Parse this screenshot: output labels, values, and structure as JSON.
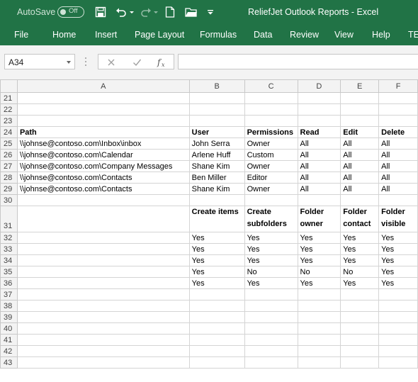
{
  "title_bar": {
    "autosave_label": "AutoSave",
    "autosave_state": "Off",
    "document_title": "ReliefJet Outlook Reports  -  Excel"
  },
  "ribbon": {
    "tabs": [
      "File",
      "Home",
      "Insert",
      "Page Layout",
      "Formulas",
      "Data",
      "Review",
      "View",
      "Help",
      "TE"
    ]
  },
  "formula_bar": {
    "name_box": "A34",
    "formula": ""
  },
  "colors": {
    "accent": "#217346",
    "header_bg": "#f3f3f3",
    "gridline": "#d4d4d4"
  },
  "sheet": {
    "columns": [
      "A",
      "B",
      "C",
      "D",
      "E",
      "F"
    ],
    "rows": [
      {
        "num": "21",
        "cells": [
          "",
          "",
          "",
          "",
          "",
          ""
        ]
      },
      {
        "num": "22",
        "cells": [
          "",
          "",
          "",
          "",
          "",
          ""
        ]
      },
      {
        "num": "23",
        "cells": [
          "",
          "",
          "",
          "",
          "",
          ""
        ]
      },
      {
        "num": "24",
        "cells": [
          "Path",
          "User",
          "Permissions",
          "Read",
          "Edit",
          "Delete"
        ],
        "bold": true
      },
      {
        "num": "25",
        "cells": [
          "\\\\johnse@contoso.com\\Inbox\\inbox",
          "John Serra",
          "Owner",
          "All",
          "All",
          "All"
        ]
      },
      {
        "num": "26",
        "cells": [
          "\\\\johnse@contoso.com\\Calendar",
          "Arlene Huff",
          "Custom",
          "All",
          "All",
          "All"
        ]
      },
      {
        "num": "27",
        "cells": [
          "\\\\johnse@contoso.com\\Company Messages",
          "Shane Kim",
          "Owner",
          "All",
          "All",
          "All"
        ]
      },
      {
        "num": "28",
        "cells": [
          "\\\\johnse@contoso.com\\Contacts",
          "Ben Miller",
          "Editor",
          "All",
          "All",
          "All"
        ]
      },
      {
        "num": "29",
        "cells": [
          "\\\\johnse@contoso.com\\Contacts",
          "Shane Kim",
          "Owner",
          "All",
          "All",
          "All"
        ]
      },
      {
        "num": "30",
        "cells": [
          "",
          "",
          "",
          "",
          "",
          ""
        ]
      },
      {
        "num": "31",
        "cells": [
          "",
          "Create items",
          "Create subfolders",
          "Folder owner",
          "Folder contact",
          "Folder visible"
        ],
        "bold": true,
        "tall": true
      },
      {
        "num": "32",
        "cells": [
          "",
          "Yes",
          "Yes",
          "Yes",
          "Yes",
          "Yes"
        ]
      },
      {
        "num": "33",
        "cells": [
          "",
          "Yes",
          "Yes",
          "Yes",
          "Yes",
          "Yes"
        ]
      },
      {
        "num": "34",
        "cells": [
          "",
          "Yes",
          "Yes",
          "Yes",
          "Yes",
          "Yes"
        ]
      },
      {
        "num": "35",
        "cells": [
          "",
          "Yes",
          "No",
          "No",
          "No",
          "Yes"
        ]
      },
      {
        "num": "36",
        "cells": [
          "",
          "Yes",
          "Yes",
          "Yes",
          "Yes",
          "Yes"
        ]
      },
      {
        "num": "37",
        "cells": [
          "",
          "",
          "",
          "",
          "",
          ""
        ]
      },
      {
        "num": "38",
        "cells": [
          "",
          "",
          "",
          "",
          "",
          ""
        ]
      },
      {
        "num": "39",
        "cells": [
          "",
          "",
          "",
          "",
          "",
          ""
        ]
      },
      {
        "num": "40",
        "cells": [
          "",
          "",
          "",
          "",
          "",
          ""
        ]
      },
      {
        "num": "41",
        "cells": [
          "",
          "",
          "",
          "",
          "",
          ""
        ]
      },
      {
        "num": "42",
        "cells": [
          "",
          "",
          "",
          "",
          "",
          ""
        ]
      },
      {
        "num": "43",
        "cells": [
          "",
          "",
          "",
          "",
          "",
          ""
        ]
      }
    ]
  }
}
